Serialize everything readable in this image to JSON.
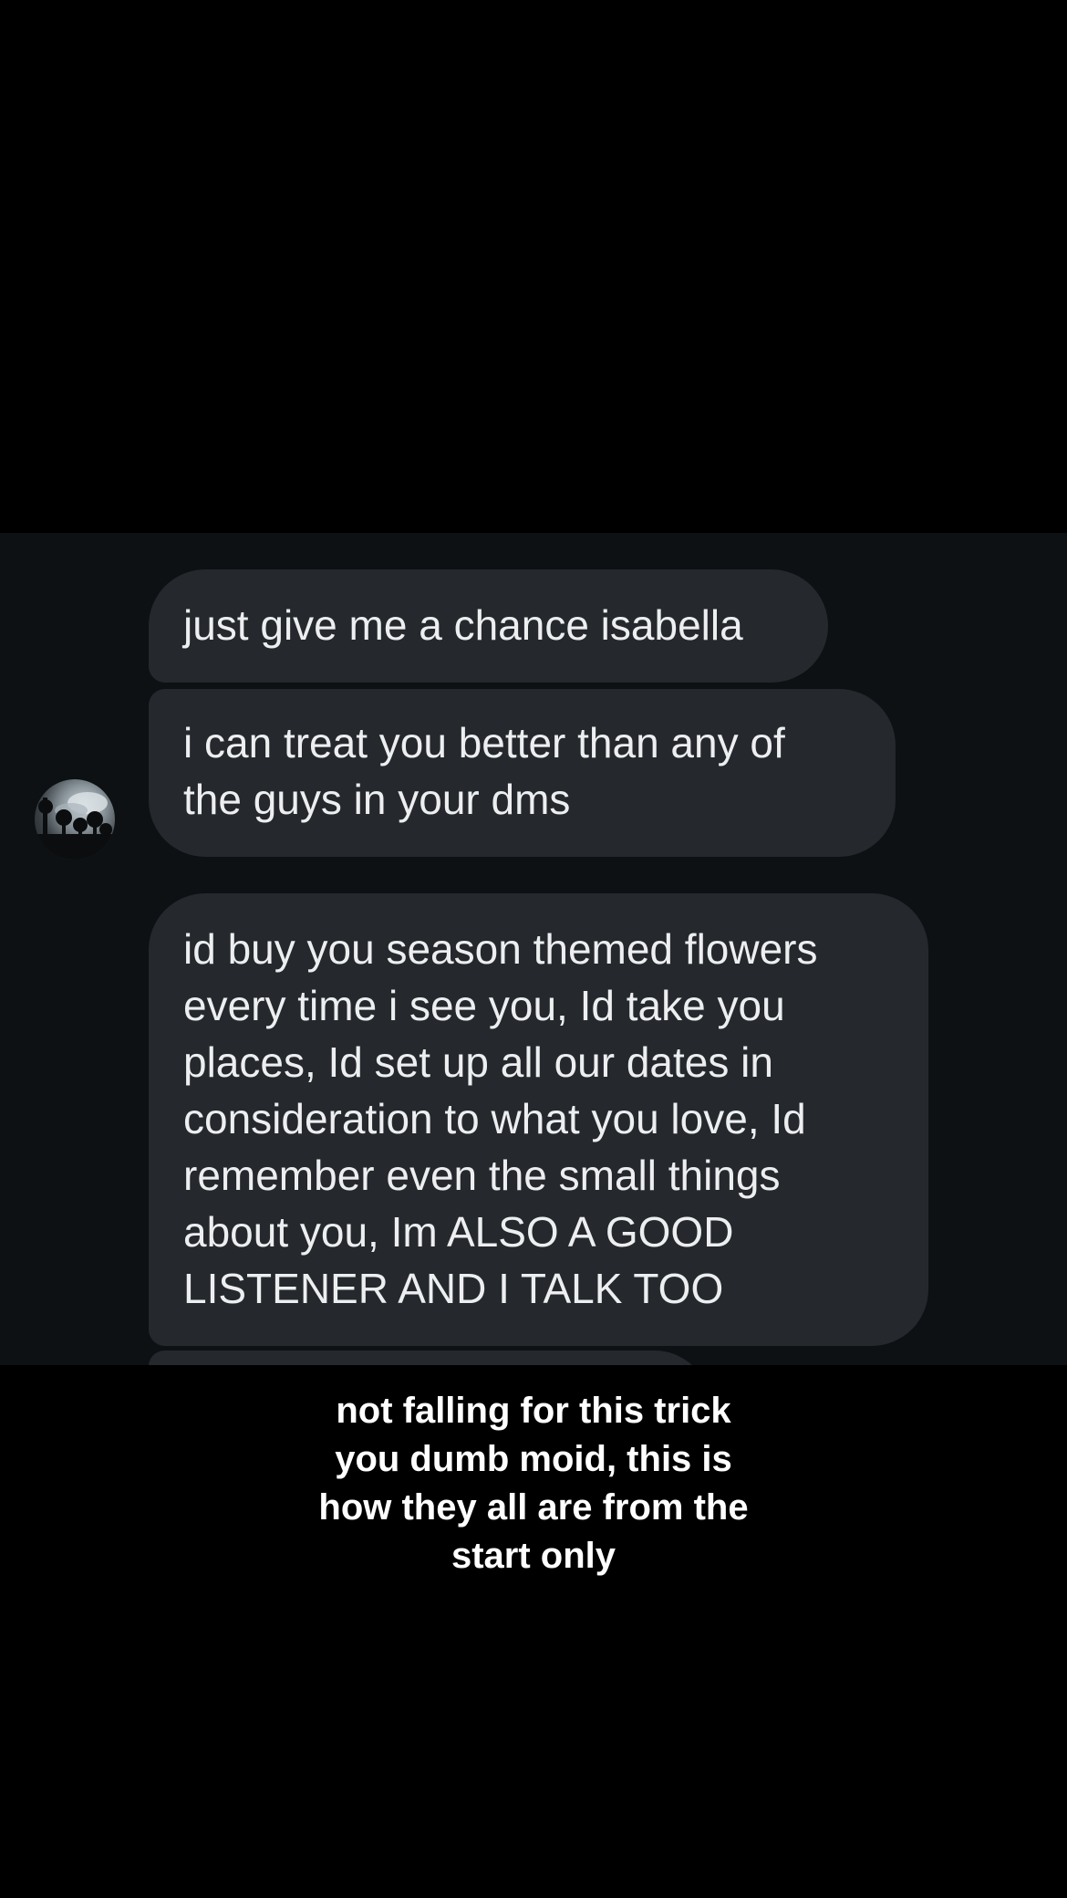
{
  "messages": [
    {
      "text": "just give me a chance isabella"
    },
    {
      "text": "i can treat you better than any of\nthe guys in your dms"
    },
    {
      "text": "id buy you season themed flowers\nevery time i see you, Id take you\nplaces, Id set up all our dates in\nconsideration to what you love, Id\nremember even the small things\nabout you, Im ALSO A GOOD\nLISTENER AND I TALK TOO"
    },
    {
      "text": ""
    }
  ],
  "caption": {
    "text": "not falling for this trick\nyou dumb moid, this is\nhow they all are from the\nstart only"
  },
  "colors": {
    "chat_background": "#0d1114",
    "bubble": "#25282c",
    "bubble_text": "#eceef0",
    "caption_text": "#ffffff"
  },
  "icons": {
    "avatar": "profile-photo-trees-sky"
  }
}
